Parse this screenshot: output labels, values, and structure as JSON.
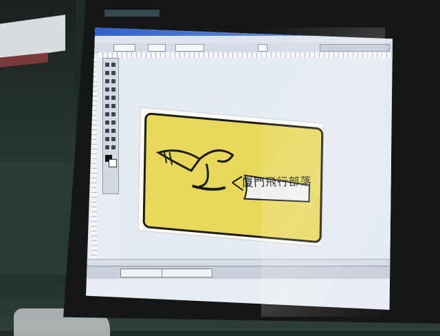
{
  "photo": {
    "subject": "computer-monitor-showing-image-editor",
    "colors": {
      "logo_fill": "#e7d85a",
      "logo_outline": "#1a1a14",
      "screen_bg": "#e4ebf2",
      "titlebar": "#2f5fc8"
    }
  },
  "app": {
    "taskbar_items": [
      "",
      ""
    ]
  },
  "logo": {
    "banner_text": "廈門飛行部落",
    "icons": [
      "paper-plane-pen-icon"
    ]
  }
}
